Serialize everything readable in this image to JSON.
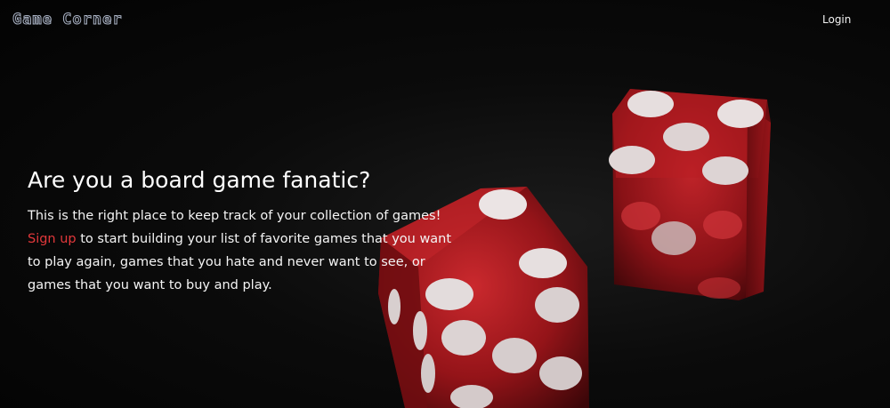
{
  "navbar": {
    "logo": "Game Corner",
    "login_label": "Login"
  },
  "hero": {
    "title": "Are you a board game fanatic?",
    "intro": "This is the right place to keep track of your collection of games!",
    "signup_label": "Sign up",
    "body_rest": "to start building your list of favorite games that you want to play again, games that you hate and never want to see, or games that you want to buy and play."
  },
  "colors": {
    "accent": "#e2383b",
    "background": "#050505",
    "dice": "#b3191e"
  },
  "images": {
    "background": "red-dice-photo"
  }
}
